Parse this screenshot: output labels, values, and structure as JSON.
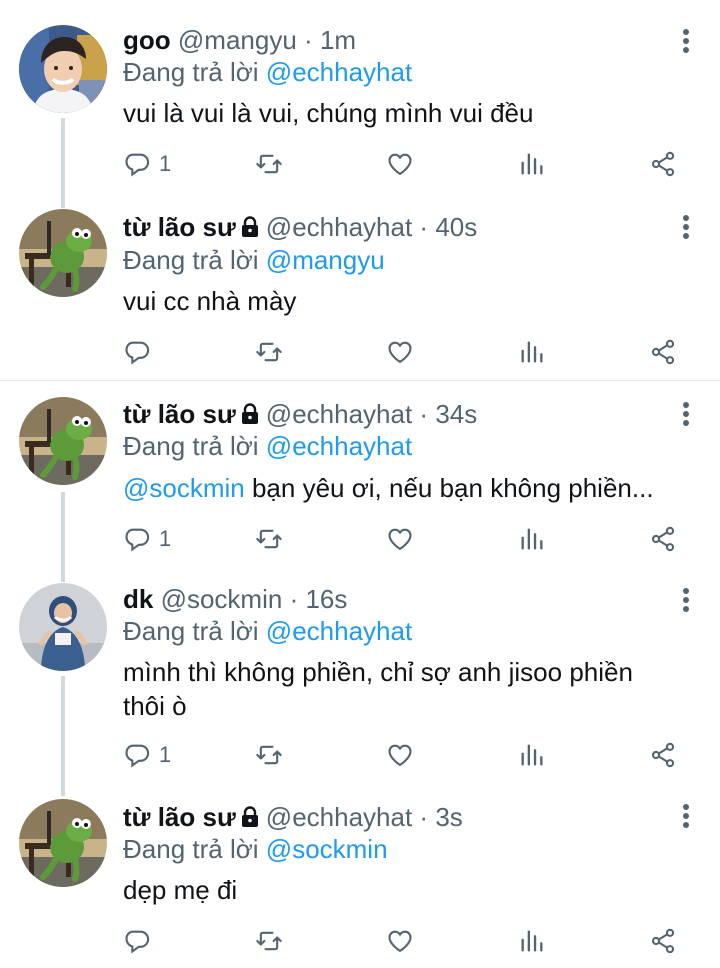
{
  "tweets": [
    {
      "name": "goo",
      "handle": "@mangyu",
      "separator": "·",
      "time": "1m",
      "locked": false,
      "reply_prefix": "Đang trả lời",
      "reply_to": "@echhayhat",
      "text_mention": "",
      "text": "vui là vui là vui, chúng mình vui đều",
      "reply_count": "1",
      "avatar": "boy-smiling-avatar"
    },
    {
      "name": "từ lão sư",
      "handle": "@echhayhat",
      "separator": "·",
      "time": "40s",
      "locked": true,
      "reply_prefix": "Đang trả lời",
      "reply_to": "@mangyu",
      "text_mention": "",
      "text": "vui cc nhà mày",
      "reply_count": "",
      "avatar": "kermit-frog-avatar"
    },
    {
      "name": "từ lão sư",
      "handle": "@echhayhat",
      "separator": "·",
      "time": "34s",
      "locked": true,
      "reply_prefix": "Đang trả lời",
      "reply_to": "@echhayhat",
      "text_mention": "@sockmin",
      "text": " bạn yêu ơi, nếu bạn không phiền...",
      "reply_count": "1",
      "avatar": "kermit-frog-avatar"
    },
    {
      "name": "dk",
      "handle": "@sockmin",
      "separator": "·",
      "time": "16s",
      "locked": false,
      "reply_prefix": "Đang trả lời",
      "reply_to": "@echhayhat",
      "text_mention": "",
      "text": "mình thì không phiền, chỉ sợ anh jisoo phiền thôi ò",
      "reply_count": "1",
      "avatar": "hooded-person-avatar"
    },
    {
      "name": "từ lão sư",
      "handle": "@echhayhat",
      "separator": "·",
      "time": "3s",
      "locked": true,
      "reply_prefix": "Đang trả lời",
      "reply_to": "@sockmin",
      "text_mention": "",
      "text": "dẹp mẹ đi",
      "reply_count": "",
      "avatar": "kermit-frog-avatar"
    }
  ],
  "icons": {
    "reply": "reply-icon",
    "retweet": "retweet-icon",
    "like": "heart-icon",
    "analytics": "analytics-icon",
    "share": "share-icon",
    "more": "more-options-icon",
    "lock": "lock-icon"
  },
  "colors": {
    "accent": "#1d9bf0",
    "muted": "#536471",
    "text": "#0f1419",
    "thread_line": "#cfd9de"
  }
}
